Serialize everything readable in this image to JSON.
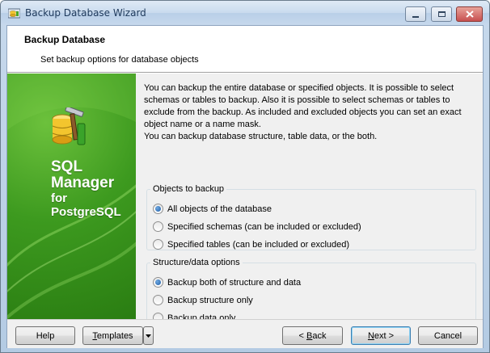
{
  "window": {
    "title": "Backup Database Wizard"
  },
  "header": {
    "title": "Backup Database",
    "subtitle": "Set backup options for database objects"
  },
  "banner": {
    "line1": "SQL",
    "line2": "Manager",
    "line3": "for",
    "line4": "PostgreSQL"
  },
  "intro": {
    "p1": "You can backup the entire database or specified objects. It is possible to select schemas or tables to backup. Also it is possible to select schemas or tables to exclude from the backup. As included and excluded objects you can set an exact object name or a name mask.",
    "p2": "You can backup database structure, table data, or the both."
  },
  "objects_group": {
    "legend": "Objects to backup",
    "options": [
      {
        "label": "All objects of the database",
        "checked": true
      },
      {
        "label": "Specified schemas (can be included or excluded)",
        "checked": false
      },
      {
        "label": "Specified tables (can be included or excluded)",
        "checked": false
      }
    ]
  },
  "structure_group": {
    "legend": "Structure/data options",
    "options": [
      {
        "label": "Backup both of structure and data",
        "checked": true
      },
      {
        "label": "Backup structure only",
        "checked": false
      },
      {
        "label": "Backup data only",
        "checked": false
      }
    ]
  },
  "buttons": {
    "help": "Help",
    "templates_u": "T",
    "templates_rest": "emplates",
    "back_pre": "< ",
    "back_u": "B",
    "back_rest": "ack",
    "next_u": "N",
    "next_rest": "ext >",
    "cancel": "Cancel"
  }
}
